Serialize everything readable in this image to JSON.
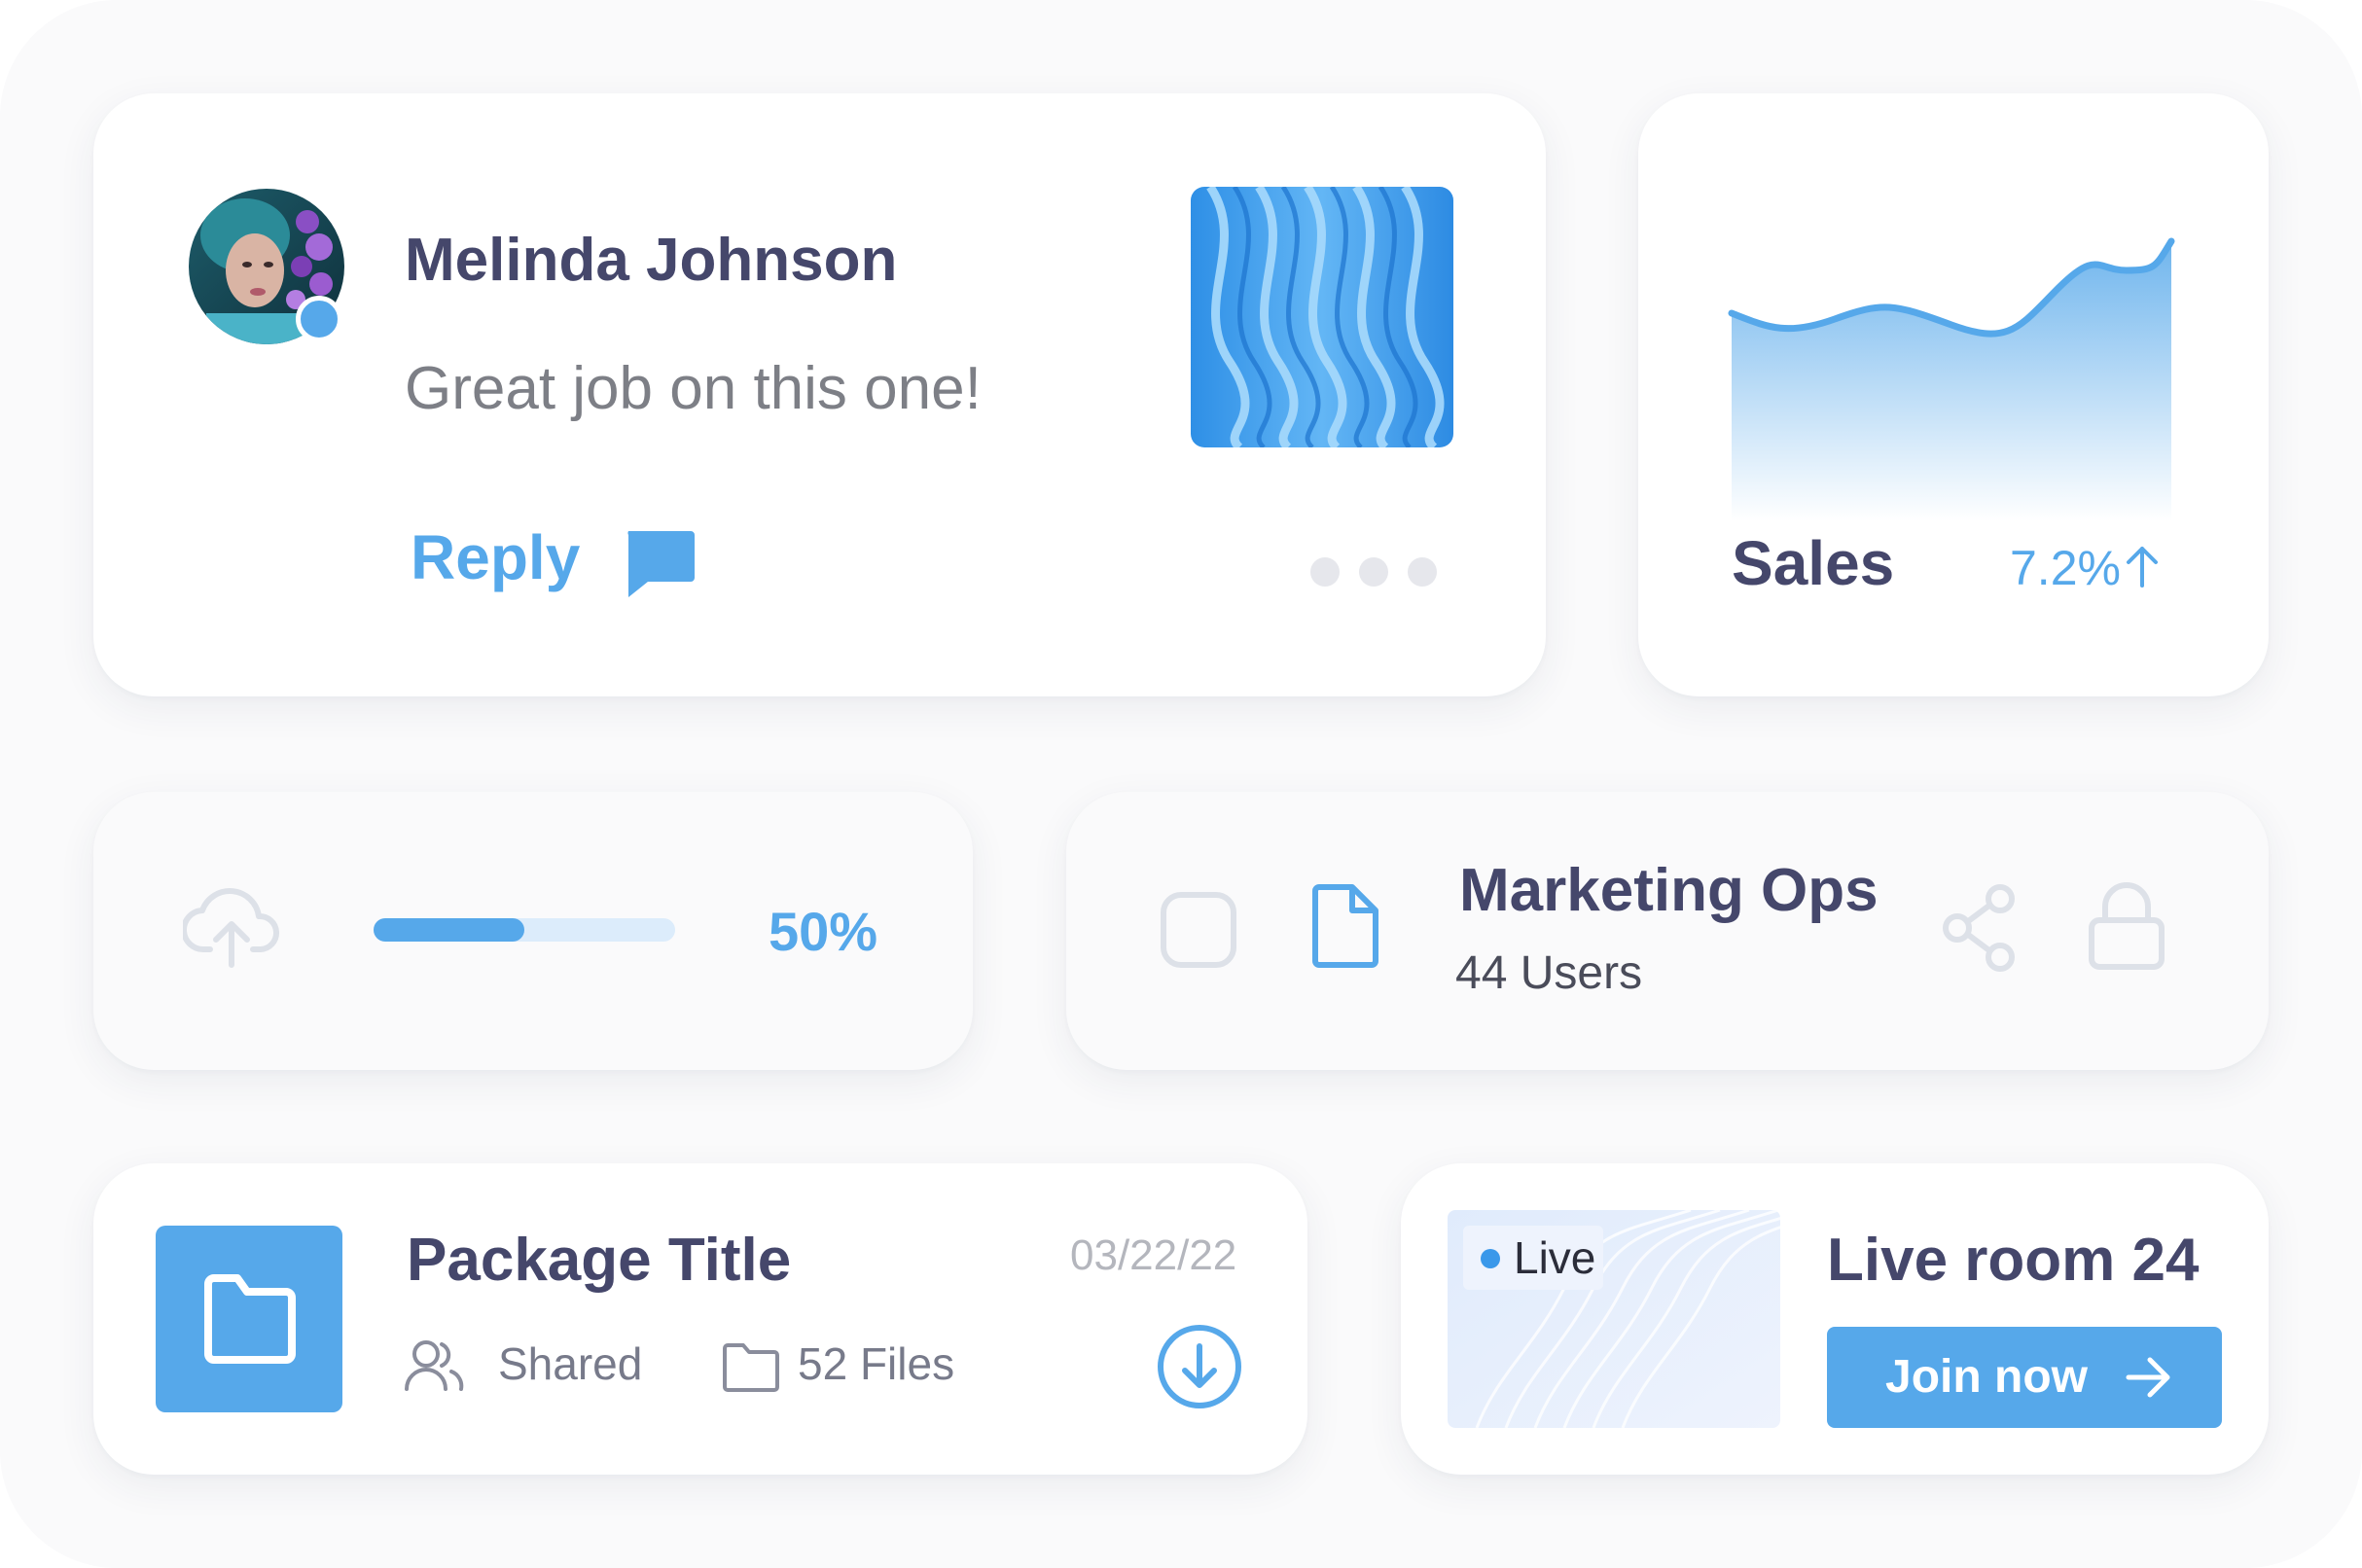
{
  "comment_card": {
    "name": "Melinda Johnson",
    "message": "Great job on this one!",
    "reply_label": "Reply"
  },
  "sales_card": {
    "label": "Sales",
    "change": "7.2%"
  },
  "upload_card": {
    "progress_percent": 50,
    "progress_label": "50%"
  },
  "group_card": {
    "title": "Marketing Ops",
    "subtitle": "44 Users"
  },
  "package_card": {
    "title": "Package Title",
    "date": "03/22/22",
    "shared_label": "Shared",
    "files_label": "52 Files"
  },
  "live_card": {
    "badge": "Live",
    "title": "Live room 24",
    "join_label": "Join now"
  },
  "colors": {
    "accent": "#56a8ea",
    "heading": "#45476b",
    "muted": "#dde1e8",
    "track": "#dcecfb"
  }
}
